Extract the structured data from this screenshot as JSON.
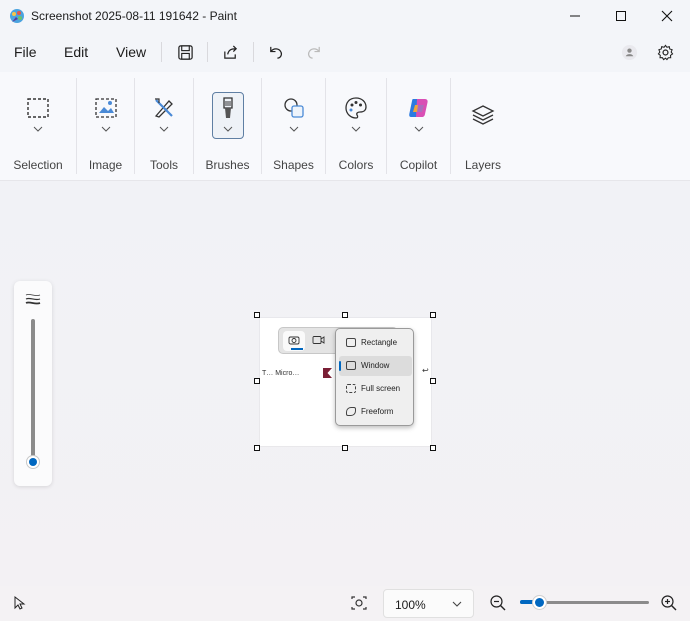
{
  "window": {
    "title": "Screenshot 2025-08-11 191642 - Paint",
    "controls": [
      "minimize",
      "maximize",
      "close"
    ]
  },
  "menu": {
    "file": "File",
    "edit": "Edit",
    "view": "View"
  },
  "toolbar_icons": [
    "save-icon",
    "share-icon",
    "undo-icon",
    "redo-icon",
    "account-icon",
    "settings-icon"
  ],
  "ribbon": {
    "groups": [
      {
        "label": "Selection",
        "icon": "selection-icon"
      },
      {
        "label": "Image",
        "icon": "image-icon"
      },
      {
        "label": "Tools",
        "icon": "tools-icon"
      },
      {
        "label": "Brushes",
        "icon": "brush-icon",
        "selected": true
      },
      {
        "label": "Shapes",
        "icon": "shapes-icon"
      },
      {
        "label": "Colors",
        "icon": "palette-icon"
      },
      {
        "label": "Copilot",
        "icon": "copilot-icon"
      },
      {
        "label": "Layers",
        "icon": "layers-icon"
      }
    ]
  },
  "canvas": {
    "bg_text": "T… Micro…",
    "snip_menu": {
      "items": [
        "Rectangle",
        "Window",
        "Full screen",
        "Freeform"
      ],
      "selected": "Window"
    }
  },
  "brush_size_slider": {
    "level": 0.0
  },
  "status": {
    "zoom_value": "100%",
    "zoom_slider_level": 0.15
  },
  "colors": {
    "accent": "#0067c0",
    "ribbon_bg": "#f8f9fc",
    "titlebar_bg": "#f3f5f9"
  }
}
